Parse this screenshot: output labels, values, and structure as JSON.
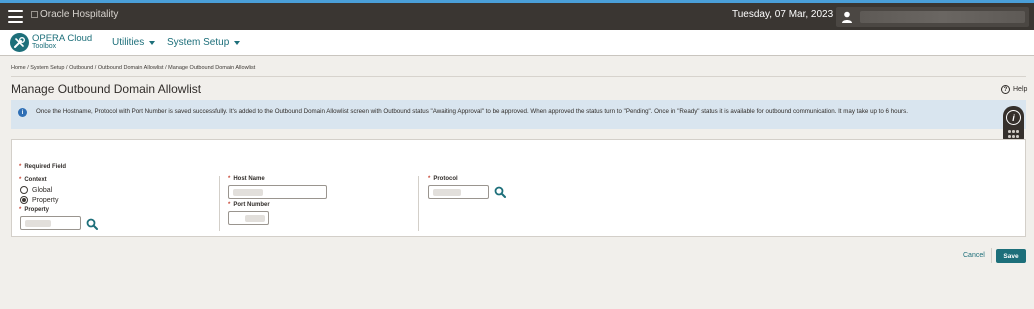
{
  "topbar": {
    "logo_alt": "Oracle Hospitality",
    "date": "Tuesday, 07 Mar, 2023"
  },
  "nav": {
    "brand_title": "OPERA Cloud",
    "brand_subtitle": "Toolbox",
    "menus": [
      "Utilities",
      "System Setup"
    ]
  },
  "breadcrumb": "Home / System Setup / Outbound / Outbound Domain Allowlist / Manage Outbound Domain Allowlist",
  "page": {
    "title": "Manage Outbound Domain Allowlist",
    "help_label": "Help"
  },
  "banner": {
    "text": "Once the Hostname, Protocol with Port Number is saved successfully. It's added to the Outbound Domain Allowlist screen with Outbound status \"Awaiting Approval\" to be approved. When approved the status turn to \"Pending\". Once in \"Ready\" status it is available for outbound communication. It may take up to 6 hours."
  },
  "form": {
    "required_note": "Required Field",
    "context_label": "Context",
    "context_options": [
      "Global",
      "Property"
    ],
    "context_selected": "Property",
    "property_label": "Property",
    "host_name_label": "Host Name",
    "port_number_label": "Port Number",
    "protocol_label": "Protocol",
    "required_marker": "*"
  },
  "actions": {
    "cancel_label": "Cancel",
    "save_label": "Save"
  },
  "colors": {
    "accent": "#1d6f7a",
    "topbar": "#3a3632",
    "banner_bg": "#d9e5ef",
    "required": "#c74634"
  }
}
